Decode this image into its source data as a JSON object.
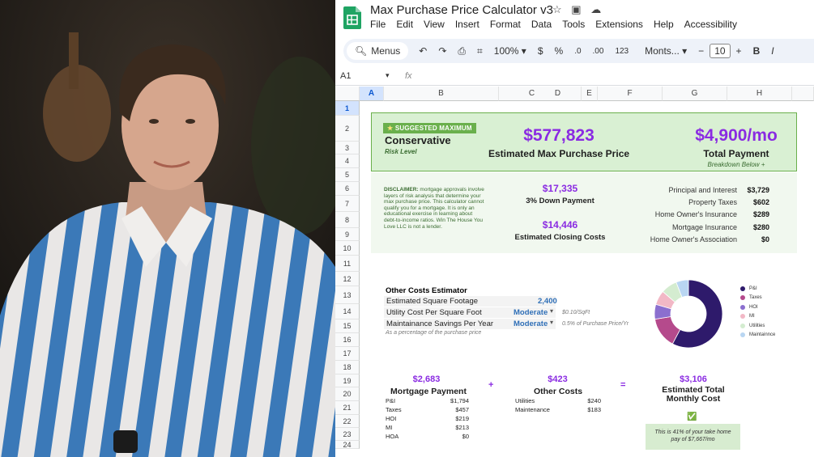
{
  "photo": {
    "subject": "man in blue and white striped shirt"
  },
  "app": {
    "title": "Max Purchase Price Calculator v3",
    "menu": [
      "File",
      "Edit",
      "View",
      "Insert",
      "Format",
      "Data",
      "Tools",
      "Extensions",
      "Help",
      "Accessibility"
    ],
    "toolbar": {
      "menus_label": "Menus",
      "zoom": "100%",
      "currency": "$",
      "percent": "%",
      "dec_less": ".0",
      "dec_more": ".00",
      "number_format": "123",
      "font": "Monts...",
      "font_size": "10",
      "minus": "−",
      "plus": "+",
      "bold": "B",
      "italic": "I"
    },
    "name_box": "A1",
    "fx": "fx",
    "columns": [
      "A",
      "B",
      "C",
      "D",
      "E",
      "F",
      "G",
      "H"
    ],
    "rows": [
      "1",
      "2",
      "3",
      "4",
      "5",
      "6",
      "7",
      "8",
      "9",
      "10",
      "11",
      "12",
      "13",
      "14",
      "15",
      "16",
      "17",
      "18",
      "19",
      "20",
      "21",
      "22",
      "23",
      "24"
    ]
  },
  "summary": {
    "badge": "SUGGESTED MAXIMUM",
    "risk_title": "Conservative",
    "risk_label": "Risk Level",
    "price_value": "$577,823",
    "price_label": "Estimated Max Purchase Price",
    "payment_value": "$4,900/mo",
    "payment_label": "Total Payment",
    "breakdown_note": "Breakdown Below +"
  },
  "disclaimer": {
    "lead": "DISCLAIMER:",
    "text": " mortgage approvals involve layers of risk analysis that determine your max purchase price. This calculator cannot qualify you for a mortgage. It is only an educational exercise in learning about debt-to-income ratios. Win The House You Love LLC is not a lender."
  },
  "down_payment": {
    "value": "$17,335",
    "label": "3% Down Payment"
  },
  "closing": {
    "value": "$14,446",
    "label": "Estimated Closing Costs"
  },
  "breakdown": [
    {
      "label": "Principal and Interest",
      "value": "$3,729"
    },
    {
      "label": "Property Taxes",
      "value": "$602"
    },
    {
      "label": "Home Owner's Insurance",
      "value": "$289"
    },
    {
      "label": "Mortgage Insurance",
      "value": "$280"
    },
    {
      "label": "Home Owner's Association",
      "value": "$0"
    }
  ],
  "other_costs": {
    "title": "Other Costs Estimator",
    "rows": [
      {
        "label": "Estimated Square Footage",
        "value": "2,400",
        "note": ""
      },
      {
        "label": "Utility Cost Per Square Foot",
        "value": "Moderate",
        "note": "$0.10/SqFt"
      },
      {
        "label": "Maintainance Savings Per Year",
        "value": "Moderate",
        "note": "0.5% of Purchase Price/Yr"
      }
    ],
    "footnote": "As a percentage of the purchase price"
  },
  "chart_data": {
    "type": "pie",
    "series_labels": [
      "P&I",
      "Taxes",
      "HOI",
      "MI",
      "Utilities",
      "Maintainnce"
    ],
    "values": [
      1794,
      457,
      219,
      213,
      240,
      183
    ],
    "colors": [
      "#2e1a6b",
      "#b54a8c",
      "#8b6fcf",
      "#f2b8c6",
      "#d4ecd0",
      "#b9d6f2"
    ]
  },
  "mortgage": {
    "value": "$2,683",
    "label": "Mortgage Payment",
    "rows": [
      [
        "P&I",
        "$1,794"
      ],
      [
        "Taxes",
        "$457"
      ],
      [
        "HOI",
        "$219"
      ],
      [
        "MI",
        "$213"
      ],
      [
        "HOA",
        "$0"
      ]
    ]
  },
  "plus": "+",
  "other": {
    "value": "$423",
    "label": "Other Costs",
    "rows": [
      [
        "Utilities",
        "$240"
      ],
      [
        "Maintenance",
        "$183"
      ]
    ]
  },
  "equals": "=",
  "total": {
    "value": "$3,106",
    "label_line1": "Estimated Total",
    "label_line2": "Monthly Cost",
    "check": "✅"
  },
  "tip": {
    "line1": "This is 41% of your take home",
    "line2": "pay of $7,667/mo"
  }
}
